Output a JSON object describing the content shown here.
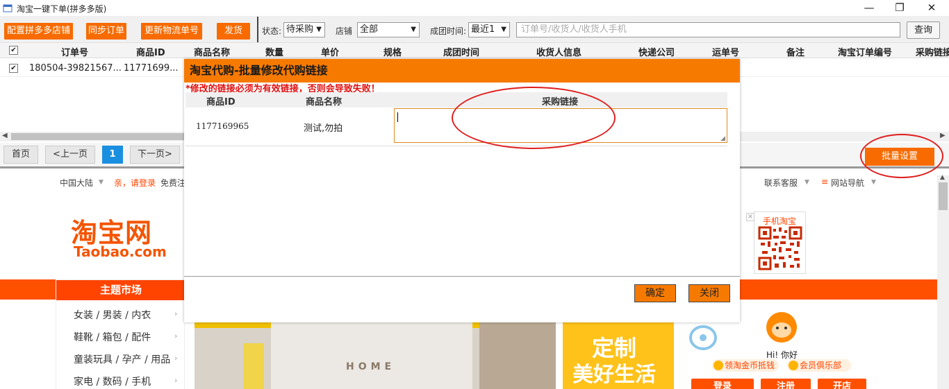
{
  "window": {
    "title": "淘宝一键下单(拼多多版)",
    "minimize": "—",
    "maximize": "❐",
    "close": "✕"
  },
  "toolbar": {
    "buttons": [
      "配置拼多多店铺",
      "同步订单",
      "更新物流单号",
      "发货"
    ],
    "status_label": "状态:",
    "status_value": "待采购",
    "shop_label": "店铺",
    "shop_value": "全部",
    "time_label": "成团时间:",
    "time_value": "最近1",
    "search_placeholder": "订单号/收货人/收货人手机",
    "query_label": "查询"
  },
  "grid": {
    "columns": [
      "订单号",
      "商品ID",
      "商品名称",
      "数量",
      "单价",
      "规格",
      "成团时间",
      "收货人信息",
      "快递公司",
      "运单号",
      "备注",
      "淘宝订单编号",
      "采购链接"
    ],
    "rows": [
      {
        "checked": "✔",
        "order_no": "180504-39821567...",
        "product_id": "11771699..."
      }
    ],
    "header_check": "✔"
  },
  "pager": {
    "first": "首页",
    "prev": "<上一页",
    "current": "1",
    "next": "下一页>",
    "batch": "批量设置"
  },
  "modal": {
    "title": "淘宝代购-批量修改代购链接",
    "warning": "*修改的链接必须为有效链接，否则会导致失败！",
    "columns": [
      "商品ID",
      "商品名称",
      "采购链接"
    ],
    "row": {
      "product_id": "1177169965",
      "product_name": "测试,勿拍",
      "link": ""
    },
    "ok": "确定",
    "close": "关闭"
  },
  "browser": {
    "region": "中国大陆",
    "login": "亲，请登录",
    "register": "免费注",
    "service": "联系客服",
    "sitemap": "网站导航",
    "logo_cn": "淘宝网",
    "logo_en": "Taobao.com",
    "mobile": "手机淘宝",
    "category_title": "主题市场",
    "categories": [
      "女装 / 男装 / 内衣",
      "鞋靴 / 箱包 / 配件",
      "童装玩具 / 孕产 / 用品",
      "家电 / 数码 / 手机"
    ],
    "banner_text": "HOME",
    "banner2_line1": "定制",
    "banner2_line2": "美好生活",
    "greeting": "Hi! 你好",
    "coin": "领淘金币抵钱",
    "club": "会员俱乐部",
    "btn_login": "登录",
    "btn_register": "注册",
    "btn_open": "开店"
  },
  "colors": {
    "accent": "#f76b00",
    "taobao": "#ff5000",
    "annotation": "#e01e1e"
  }
}
